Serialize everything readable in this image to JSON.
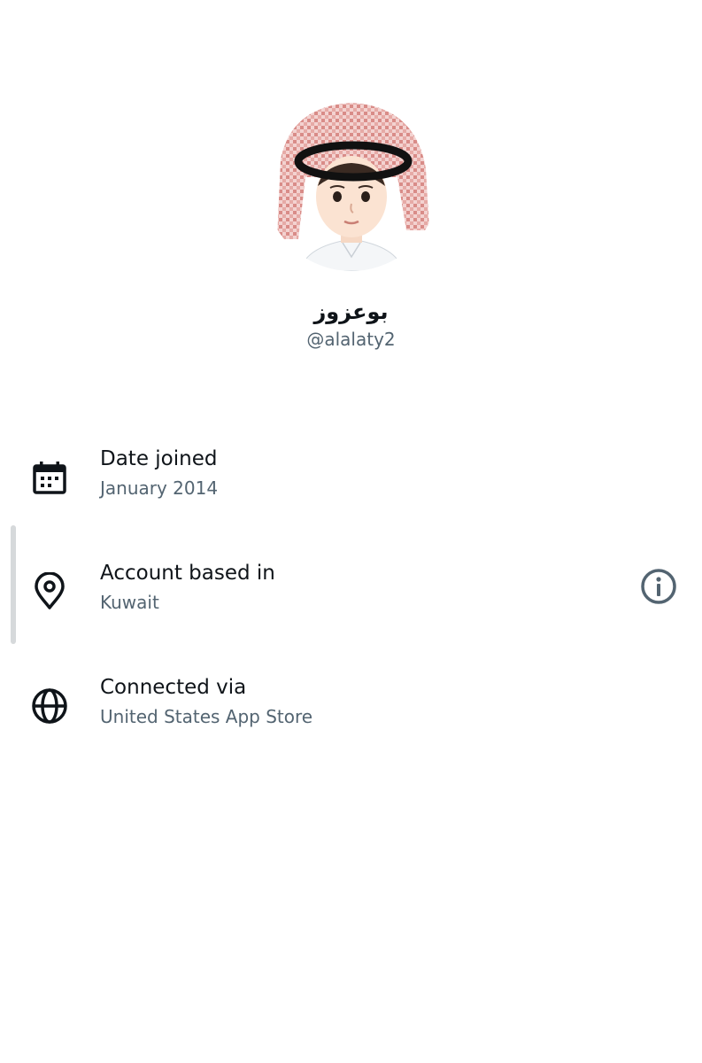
{
  "profile": {
    "display_name": "بوعزوز",
    "handle": "@alalaty2"
  },
  "about": {
    "rows": [
      {
        "icon": "calendar-icon",
        "label": "Date joined",
        "value": "January 2014"
      },
      {
        "icon": "location-pin-icon",
        "label": "Account based in",
        "value": "Kuwait",
        "action_icon": "info-icon"
      },
      {
        "icon": "globe-icon",
        "label": "Connected via",
        "value": "United States App Store"
      }
    ]
  },
  "colors": {
    "primary_text": "#0f1419",
    "secondary_text": "#536471",
    "background": "#ffffff",
    "scroll_indicator": "#d6d9db"
  }
}
